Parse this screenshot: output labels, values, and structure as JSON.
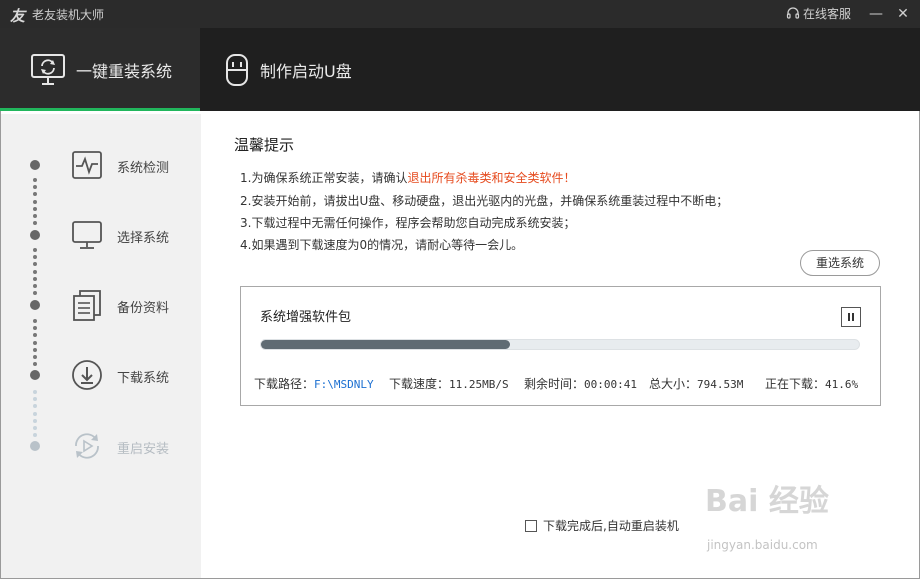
{
  "titlebar": {
    "logo_glyph": "友",
    "app_title": "老友装机大师",
    "service_label": "在线客服",
    "minimize_glyph": "—",
    "close_glyph": "✕"
  },
  "nav": {
    "tabs": [
      {
        "label": "一键重装系统",
        "icon": "monitor-refresh-icon",
        "active": true
      },
      {
        "label": "制作启动U盘",
        "icon": "usb-drive-icon",
        "active": false
      }
    ],
    "accent_color": "#21b65c"
  },
  "steps": [
    {
      "label": "系统检测",
      "icon": "heartbeat-monitor-icon",
      "enabled": true
    },
    {
      "label": "选择系统",
      "icon": "desktop-icon",
      "enabled": true
    },
    {
      "label": "备份资料",
      "icon": "documents-icon",
      "enabled": true
    },
    {
      "label": "下载系统",
      "icon": "download-icon",
      "enabled": true
    },
    {
      "label": "重启安装",
      "icon": "restart-icon",
      "enabled": false
    }
  ],
  "tips": {
    "title": "温馨提示",
    "line1_prefix": "1.为确保系统正常安装，请确认",
    "line1_warning": "退出所有杀毒类和安全类软件！",
    "line2": "2.安装开始前，请拔出U盘、移动硬盘，退出光驱内的光盘，并确保系统重装过程中不断电；",
    "line3": "3.下载过程中无需任何操作，程序会帮助您自动完成系统安装；",
    "line4": "4.如果遇到下载速度为0的情况，请耐心等待一会儿。",
    "warning_color": "#e64b1f"
  },
  "reselect_label": "重选系统",
  "download": {
    "package_name": "系统增强软件包",
    "progress_percent": 41.6,
    "path_label": "下载路径：",
    "path_value": "F:\\MSDNLY",
    "speed_label": "下载速度：",
    "speed_value": "11.25MB/S",
    "remaining_label": "剩余时间：",
    "remaining_value": "00:00:41",
    "size_label": "总大小：",
    "size_value": "794.53M",
    "status_label": "正在下载：",
    "status_value": "41.6%"
  },
  "auto_restart_label": "下载完成后,自动重启装机",
  "watermark": {
    "main": "Bai 经验",
    "sub": "jingyan.baidu.com"
  }
}
